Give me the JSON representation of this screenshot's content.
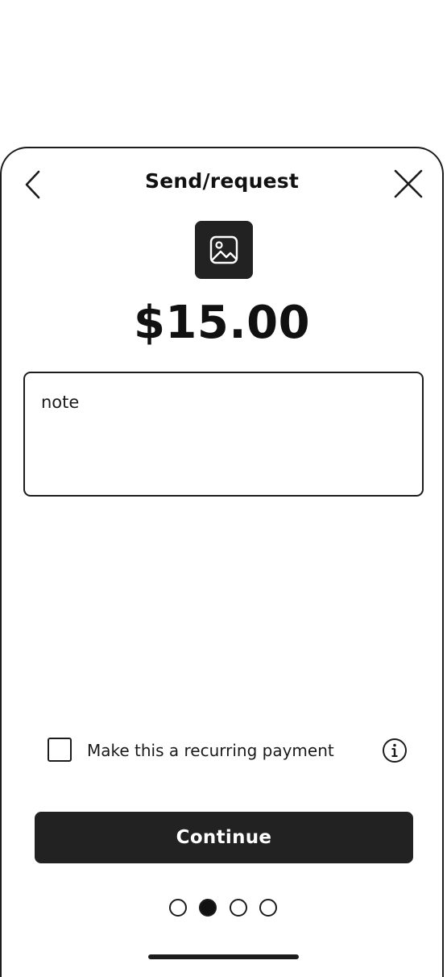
{
  "header": {
    "title": "Send/request",
    "back_icon": "chevron-left-icon",
    "close_icon": "close-icon"
  },
  "recipient": {
    "avatar_icon": "image-placeholder-icon"
  },
  "amount": "$15.00",
  "note": {
    "placeholder": "note"
  },
  "recurring": {
    "label": "Make this a recurring payment",
    "checked": false,
    "info_icon": "info-icon"
  },
  "actions": {
    "continue_label": "Continue"
  },
  "pagination": {
    "total": 4,
    "current": 2
  },
  "colors": {
    "primary_button": "#222222",
    "text": "#111111",
    "background": "#ffffff"
  }
}
